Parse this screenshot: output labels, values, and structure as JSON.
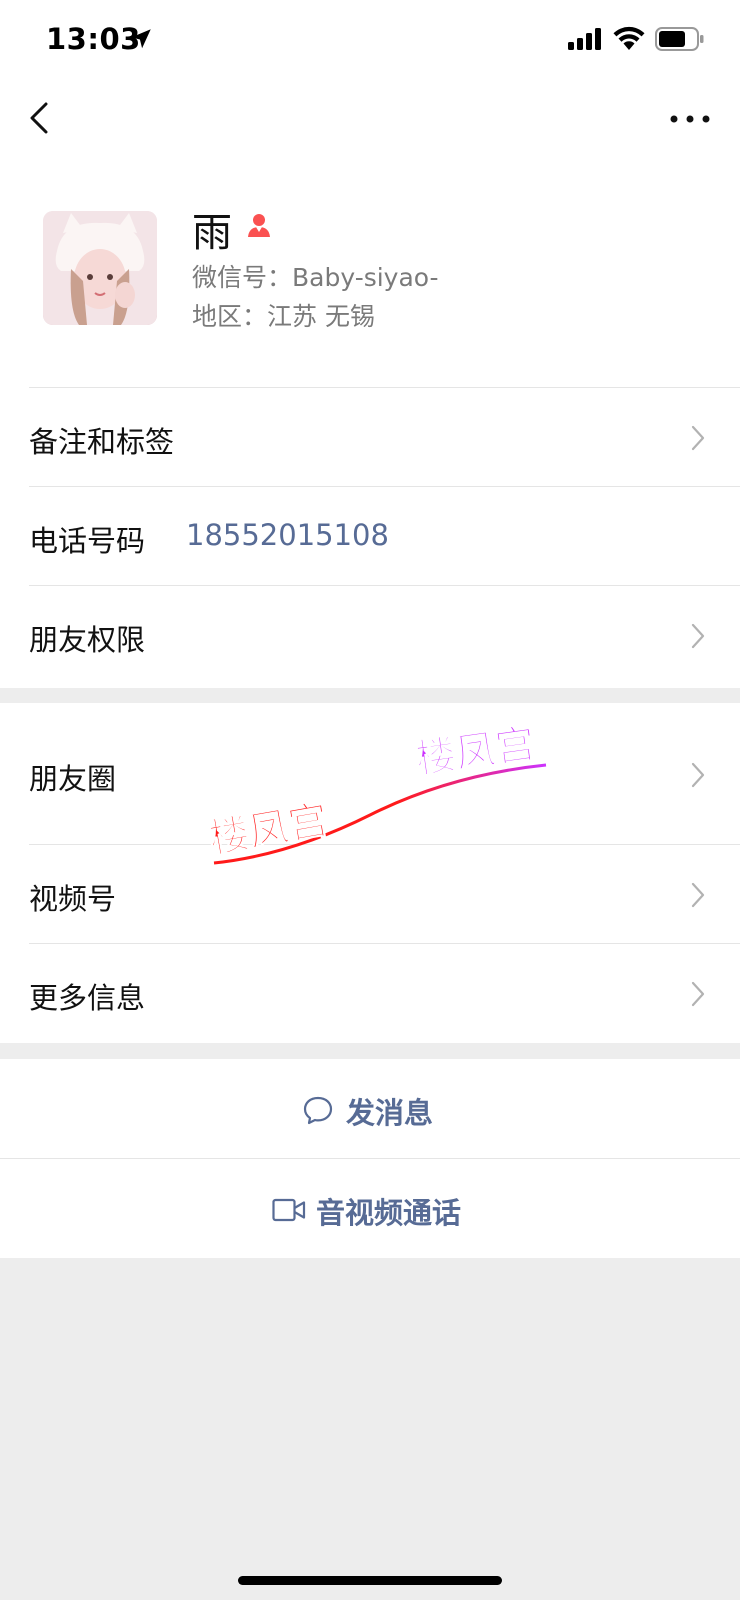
{
  "status_bar": {
    "time": "13:03"
  },
  "nav": {
    "back_icon": "chevron-left-icon",
    "more_icon": "more-icon"
  },
  "profile": {
    "name": "雨",
    "wechat_id": "微信号：Baby-siyao-",
    "region": "地区：江苏 无锡",
    "gender_icon": "female-icon",
    "gender_color": "#fa5151"
  },
  "rows": {
    "remark": {
      "label": "备注和标签"
    },
    "phone": {
      "label": "电话号码",
      "value": "18552015108"
    },
    "permissions": {
      "label": "朋友权限"
    },
    "moments": {
      "label": "朋友圈"
    },
    "channels": {
      "label": "视频号"
    },
    "more_info": {
      "label": "更多信息"
    }
  },
  "actions": {
    "message": {
      "label": "发消息",
      "icon": "chat-bubble-icon"
    },
    "call": {
      "label": "音视频通话",
      "icon": "video-camera-icon"
    }
  },
  "watermark": {
    "text_left": "楼凤宫",
    "text_right": "楼凤宫",
    "color_left": "#ff1a1a",
    "color_right": "#cc33ff"
  },
  "colors": {
    "link": "#576b95",
    "background": "#ededed"
  }
}
